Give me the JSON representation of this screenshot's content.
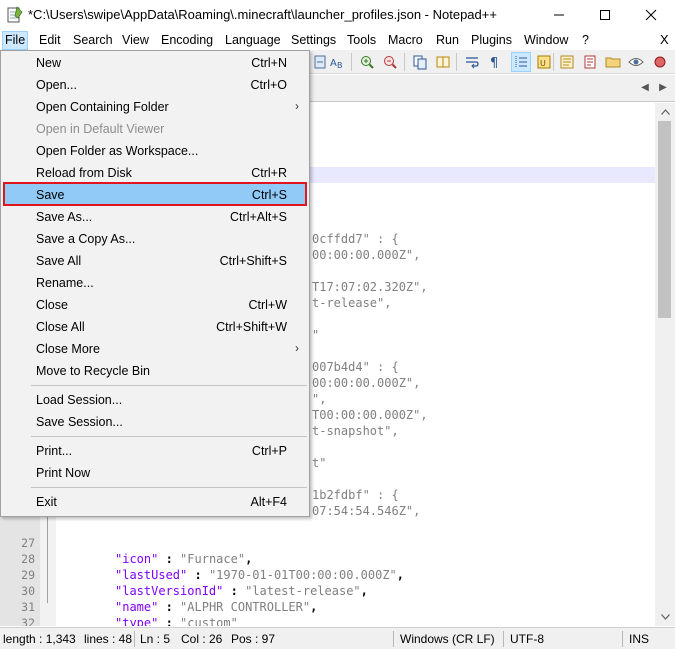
{
  "window": {
    "title": "*C:\\Users\\swipe\\AppData\\Roaming\\.minecraft\\launcher_profiles.json - Notepad++",
    "icon": "notepad-icon",
    "controls": [
      "minimize-icon",
      "maximize-icon",
      "close-icon"
    ]
  },
  "menubar": {
    "items": [
      "File",
      "Edit",
      "Search",
      "View",
      "Encoding",
      "Language",
      "Settings",
      "Tools",
      "Macro",
      "Run",
      "Plugins",
      "Window",
      "?"
    ],
    "active": "File",
    "close_label": "X"
  },
  "file_menu": {
    "items": [
      {
        "label": "New",
        "shortcut": "Ctrl+N"
      },
      {
        "label": "Open...",
        "shortcut": "Ctrl+O"
      },
      {
        "label": "Open Containing Folder",
        "shortcut": "",
        "submenu": true
      },
      {
        "label": "Open in Default Viewer",
        "shortcut": "",
        "disabled": true
      },
      {
        "label": "Open Folder as Workspace...",
        "shortcut": ""
      },
      {
        "label": "Reload from Disk",
        "shortcut": "Ctrl+R"
      },
      {
        "label": "Save",
        "shortcut": "Ctrl+S",
        "highlighted": true
      },
      {
        "label": "Save As...",
        "shortcut": "Ctrl+Alt+S"
      },
      {
        "label": "Save a Copy As...",
        "shortcut": ""
      },
      {
        "label": "Save All",
        "shortcut": "Ctrl+Shift+S"
      },
      {
        "label": "Rename...",
        "shortcut": ""
      },
      {
        "label": "Close",
        "shortcut": "Ctrl+W"
      },
      {
        "label": "Close All",
        "shortcut": "Ctrl+Shift+W"
      },
      {
        "label": "Close More",
        "shortcut": "",
        "submenu": true
      },
      {
        "label": "Move to Recycle Bin",
        "shortcut": ""
      },
      {
        "label": "Load Session...",
        "shortcut": ""
      },
      {
        "label": "Save Session...",
        "shortcut": ""
      },
      {
        "label": "Print...",
        "shortcut": "Ctrl+P"
      },
      {
        "label": "Print Now",
        "shortcut": ""
      },
      {
        "label": "Exit",
        "shortcut": "Alt+F4"
      }
    ],
    "highlight_color": "#e0161f"
  },
  "editor": {
    "visible_fragments": [
      {
        "text": "0cffdd7\" : {"
      },
      {
        "text": "00:00:00.000Z\","
      },
      {
        "text": "T17:07:02.320Z\","
      },
      {
        "text": "t-release\","
      },
      {
        "text": "\""
      },
      {
        "text": "007b4d4\" : {"
      },
      {
        "text": "00:00:00.000Z\","
      },
      {
        "text": "\","
      },
      {
        "text": "T00:00:00.000Z\","
      },
      {
        "text": "t-snapshot\","
      },
      {
        "text": "t\""
      },
      {
        "text": "1b2fdbf\" : {"
      },
      {
        "text": "07:54:54.546Z\","
      }
    ],
    "lines": [
      {
        "n": "27",
        "key": "\"icon\"",
        "sep": " : ",
        "val": "\"Furnace\"",
        "end": ","
      },
      {
        "n": "28",
        "key": "\"lastUsed\"",
        "sep": " : ",
        "val": "\"1970-01-01T00:00:00.000Z\"",
        "end": ","
      },
      {
        "n": "29",
        "key": "\"lastVersionId\"",
        "sep": " : ",
        "val": "\"latest-release\"",
        "end": ","
      },
      {
        "n": "30",
        "key": "\"name\"",
        "sep": " : ",
        "val": "\"ALPHR CONTROLLER\"",
        "end": ","
      },
      {
        "n": "31",
        "key": "\"type\"",
        "sep": " : ",
        "val": "\"custom\"",
        "end": ""
      },
      {
        "n": "32",
        "key": "",
        "sep": "",
        "val": "",
        "end": "}"
      }
    ],
    "colors": {
      "key": "#8000ff",
      "string": "#808080",
      "current_line": "#e8e8ff"
    }
  },
  "statusbar": {
    "length": "length : 1,343",
    "lines": "lines : 48",
    "ln": "Ln : 5",
    "col": "Col : 26",
    "pos": "Pos : 97",
    "eol": "Windows (CR LF)",
    "encoding": "UTF-8",
    "mode": "INS"
  }
}
